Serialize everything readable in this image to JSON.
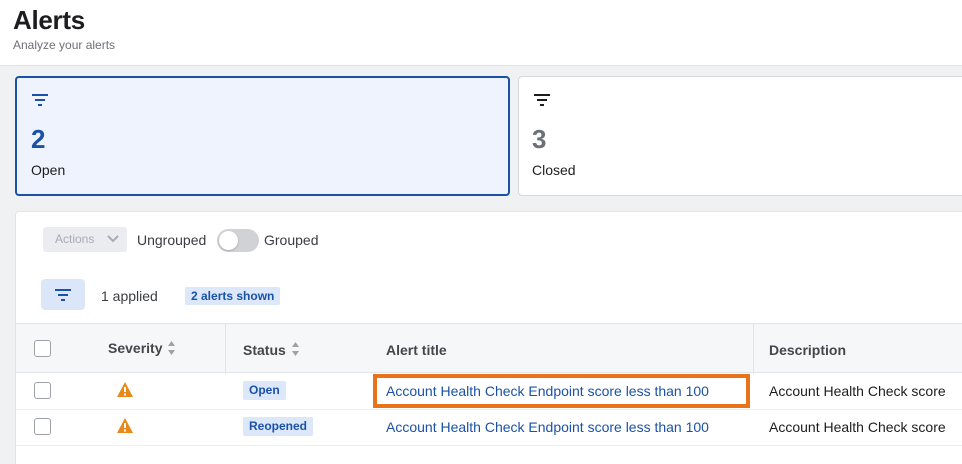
{
  "header": {
    "title": "Alerts",
    "subtitle": "Analyze your alerts"
  },
  "cards": [
    {
      "count": "2",
      "label": "Open",
      "selected": true,
      "icon": "filter-icon"
    },
    {
      "count": "3",
      "label": "Closed",
      "selected": false,
      "icon": "filter-icon"
    }
  ],
  "toolbar": {
    "actions_label": "Actions",
    "ungrouped_label": "Ungrouped",
    "grouped_label": "Grouped",
    "grouped_on": false,
    "applied_text": "1 applied",
    "shown_badge": "2 alerts shown"
  },
  "table": {
    "columns": [
      "Severity",
      "Status",
      "Alert title",
      "Description"
    ],
    "rows": [
      {
        "severity_icon": "warning-icon",
        "status": "Open",
        "title": "Account Health Check Endpoint score less than 100",
        "description": "Account Health Check score"
      },
      {
        "severity_icon": "warning-icon",
        "status": "Reopened",
        "title": "Account Health Check Endpoint score less than 100",
        "description": "Account Health Check score"
      }
    ]
  },
  "colors": {
    "accent": "#1a52a8",
    "warning": "#e8891c",
    "highlight": "#e8731a",
    "selected_bg": "#eef3fd"
  }
}
